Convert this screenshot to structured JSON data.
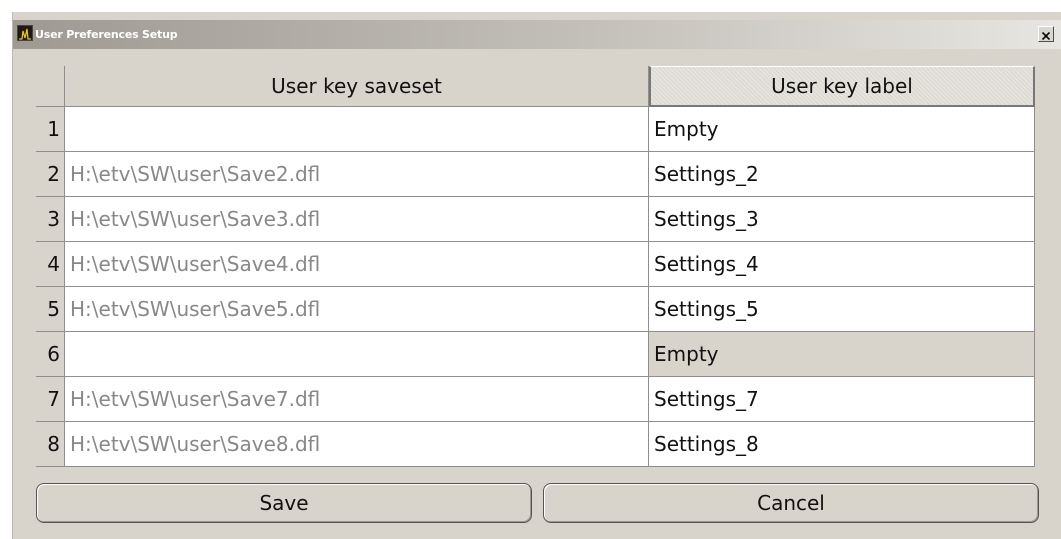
{
  "window": {
    "title": "User Preferences Setup",
    "app_icon": "spectrum-analyzer-icon",
    "close_icon": "close-icon"
  },
  "table": {
    "columns": [
      "User key saveset",
      "User key label"
    ],
    "rows": [
      {
        "num": "1",
        "saveset": "",
        "label": "Empty"
      },
      {
        "num": "2",
        "saveset": "H:\\etv\\SW\\user\\Save2.dfl",
        "label": "Settings_2"
      },
      {
        "num": "3",
        "saveset": "H:\\etv\\SW\\user\\Save3.dfl",
        "label": "Settings_3"
      },
      {
        "num": "4",
        "saveset": "H:\\etv\\SW\\user\\Save4.dfl",
        "label": "Settings_4"
      },
      {
        "num": "5",
        "saveset": "H:\\etv\\SW\\user\\Save5.dfl",
        "label": "Settings_5"
      },
      {
        "num": "6",
        "saveset": "",
        "label": "Empty"
      },
      {
        "num": "7",
        "saveset": "H:\\etv\\SW\\user\\Save7.dfl",
        "label": "Settings_7"
      },
      {
        "num": "8",
        "saveset": "H:\\etv\\SW\\user\\Save8.dfl",
        "label": "Settings_8"
      }
    ],
    "selected_row": 6
  },
  "buttons": {
    "save": "Save",
    "cancel": "Cancel"
  }
}
